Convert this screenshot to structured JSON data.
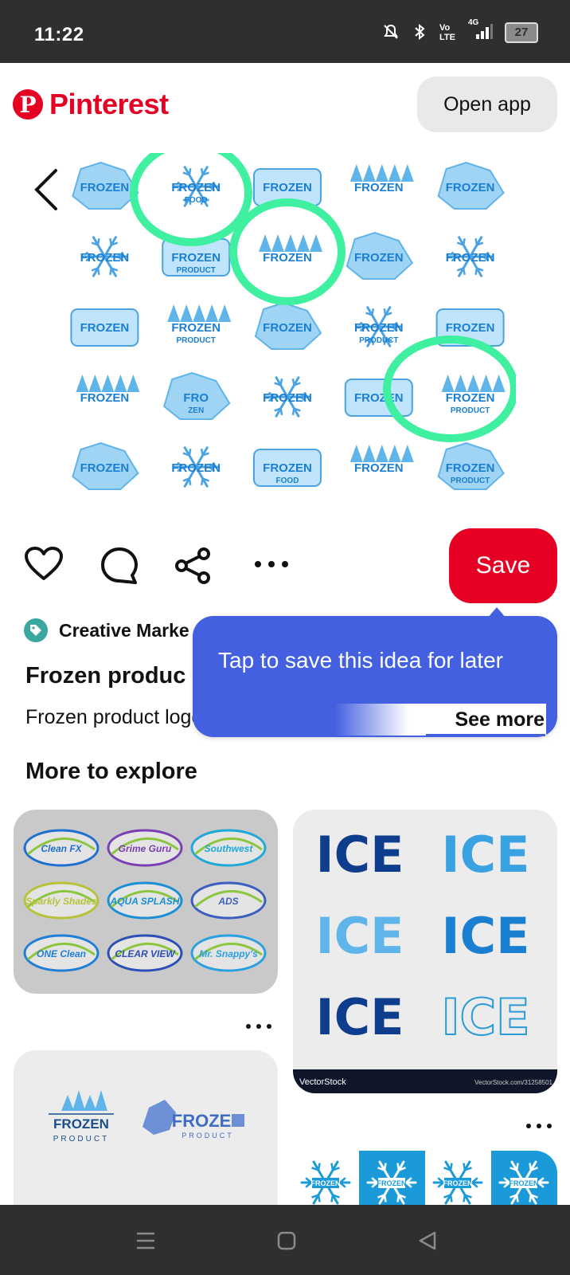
{
  "status_bar": {
    "time": "11:22",
    "network_label": "4G",
    "volte_label": "Vo LTE",
    "battery": "27"
  },
  "header": {
    "brand": "Pinterest",
    "open_app_label": "Open app"
  },
  "pin": {
    "image_labels": [
      "FROZEN",
      "FROZEN FOOD",
      "FROZEN",
      "FROZEN",
      "FROZEN",
      "FROZEN",
      "FROZEN PRODUCT",
      "FROZEN",
      "FROZEN",
      "FROZEN",
      "FROZEN",
      "FROZEN PRODUCT",
      "FROZEN",
      "FROZEN PRODUCT",
      "FROZEN",
      "FROZEN",
      "FRO ZEN",
      "FROZEN",
      "FROZEN",
      "FROZEN PRODUCT",
      "FROZEN",
      "FROZEN",
      "FROZEN FOOD",
      "FROZEN",
      "FROZEN PRODUCT"
    ],
    "save_label": "Save",
    "source_name": "Creative Marke",
    "title": "Frozen produc",
    "description": "Frozen product logo. Snow and winter s",
    "see_more": "See more"
  },
  "tooltip": {
    "text": "Tap to save this idea for later"
  },
  "explore": {
    "heading": "More to explore",
    "card1_logos": [
      "Clean FX",
      "Grime Guru",
      "Southwest",
      "Sparkly Shades",
      "AQUA SPLASH",
      "ADS",
      "ONE Clean",
      "CLEAR VIEW",
      "Mr. Snappy's"
    ],
    "card2_words": [
      "ICE",
      "ICE",
      "ICE",
      "ICE",
      "ICE",
      "ICE"
    ],
    "card2_footer_left": "VectorStock",
    "card2_footer_right": "VectorStock.com/31258501",
    "card3_labels": [
      "FROZEN",
      "PRODUCT",
      "FROZEN",
      "PRODUCT"
    ],
    "card4_labels": [
      "FROZEN",
      "FROZEN",
      "FROZEN",
      "FROZEN"
    ]
  },
  "colors": {
    "brand_red": "#e60023",
    "tooltip_blue": "#4360e0",
    "highlight_green": "#3ef0a0",
    "ice_blue": "#1a7fd0"
  }
}
